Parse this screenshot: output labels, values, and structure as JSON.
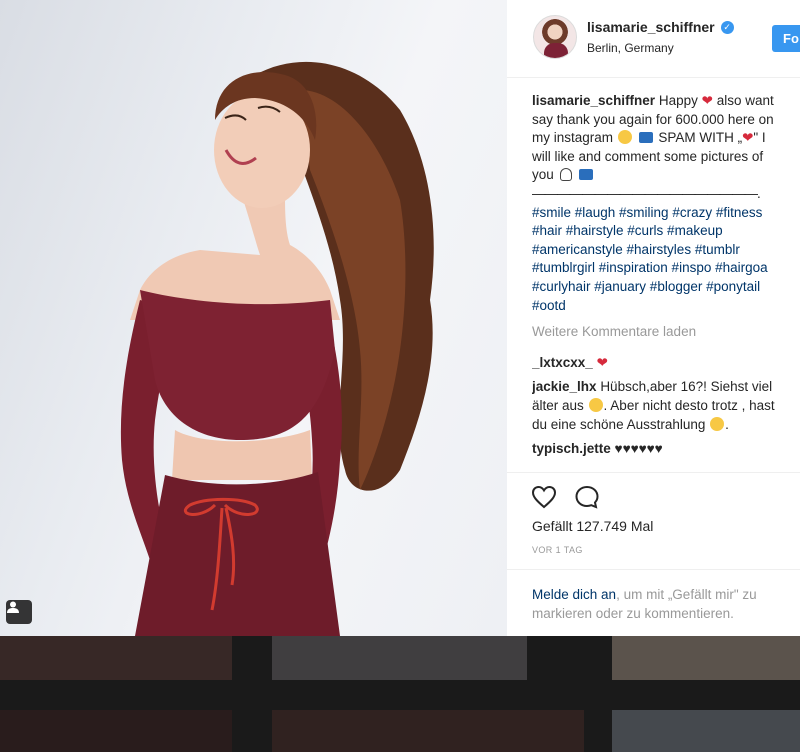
{
  "post": {
    "username": "lisamarie_schiffner",
    "location": "Berlin, Germany",
    "follow_label": "Fo",
    "caption": {
      "username": "lisamarie_schiffner",
      "line1": "Happy",
      "line1b": "also want",
      "line2": "say thank you again for 600.000 here on",
      "line3a": "my instagram",
      "line3b": "SPAM WITH „",
      "line3c": "\" I",
      "line4": "will like and comment some pictures of",
      "line5": "you",
      "divider": "——————————————————.",
      "hashtags": [
        "#smile #laugh #smiling #crazy #fitness",
        "#hair #hairstyle #curls #makeup",
        "#americanstyle #hairstyles #tumblr",
        "#tumblrgirl #inspiration #inspo #hairgoa",
        "#curlyhair #january #blogger #ponytail",
        "#ootd"
      ]
    },
    "load_more": "Weitere Kommentare laden",
    "comments": [
      {
        "username": "_lxtxcxx_",
        "text": ""
      },
      {
        "username": "jackie_lhx",
        "text_lines": [
          "Hübsch,aber 16?! Siehst viel",
          "älter aus",
          ". Aber nicht desto trotz , hast",
          "du eine schöne Ausstrahlung"
        ]
      },
      {
        "username": "typisch.jette",
        "text": "♥♥♥♥♥♥"
      }
    ],
    "likes": "Gefällt 127.749 Mal",
    "time": "VOR 1 TAG",
    "login_prompt": {
      "link": "Melde dich an",
      "rest1": ", um mit „Gefällt mir\" zu",
      "line2": "markieren oder zu kommentieren."
    }
  },
  "icons": {
    "verified": "verified-badge-icon",
    "like": "heart-outline-icon",
    "comment": "comment-bubble-icon",
    "user_tag": "user-tag-icon"
  },
  "colors": {
    "accent": "#3897f0",
    "hashtag": "#003569",
    "muted": "#999999",
    "heart": "#d62a3c",
    "outfit": "#7a1f2e"
  }
}
